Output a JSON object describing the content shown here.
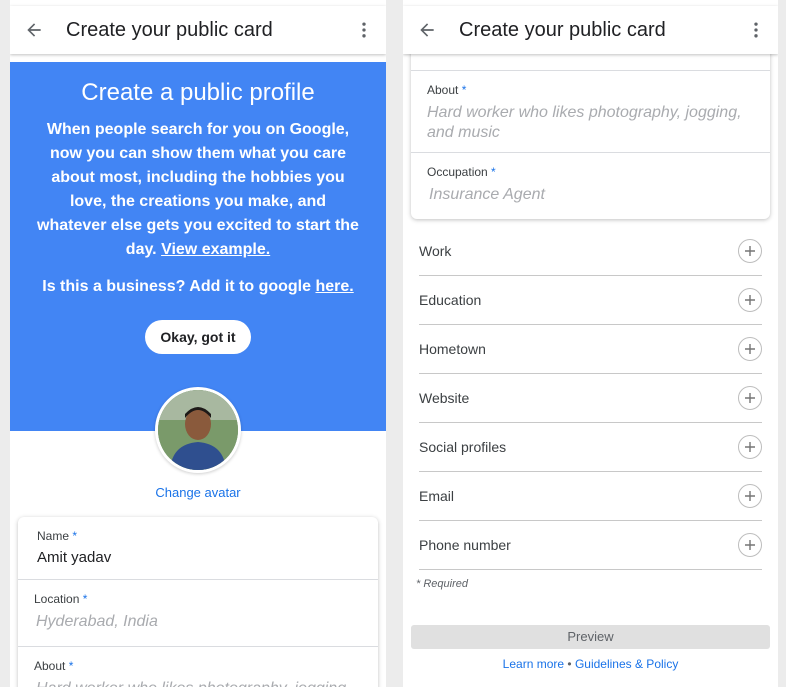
{
  "left": {
    "appbar": {
      "title": "Create your public card"
    },
    "hero": {
      "heading": "Create a public profile",
      "description": "When people search for you on Google, now you can show them what you care about most, including the hobbies you love, the creations you make, and whatever else gets you excited to start the day.",
      "view_example": "View example.",
      "business_text": "Is this a business? Add it to google",
      "business_link": "here.",
      "ok_button": "Okay, got it"
    },
    "change_avatar": "Change avatar",
    "fields": {
      "name": {
        "label": "Name",
        "required": "*",
        "value": "Amit yadav"
      },
      "location": {
        "label": "Location",
        "required": "*",
        "placeholder": "Hyderabad, India"
      },
      "about": {
        "label": "About",
        "required": "*",
        "placeholder": "Hard worker who likes photography, jogging"
      }
    }
  },
  "right": {
    "appbar": {
      "title": "Create your public card"
    },
    "fields": {
      "about": {
        "label": "About",
        "required": "*",
        "placeholder": "Hard worker who likes photography, jogging, and music"
      },
      "occupation": {
        "label": "Occupation",
        "required": "*",
        "placeholder": "Insurance Agent"
      }
    },
    "sections": [
      "Work",
      "Education",
      "Hometown",
      "Website",
      "Social profiles",
      "Email",
      "Phone number"
    ],
    "required_note": "* Required",
    "preview_button": "Preview",
    "footer": {
      "learn_more": "Learn more",
      "separator": "•",
      "guidelines": "Guidelines & Policy"
    }
  },
  "colors": {
    "hero_blue": "#4285f4",
    "link_blue": "#1a73e8"
  },
  "icons": [
    "arrow-back-icon",
    "more-vert-icon",
    "plus-circle-icon"
  ]
}
